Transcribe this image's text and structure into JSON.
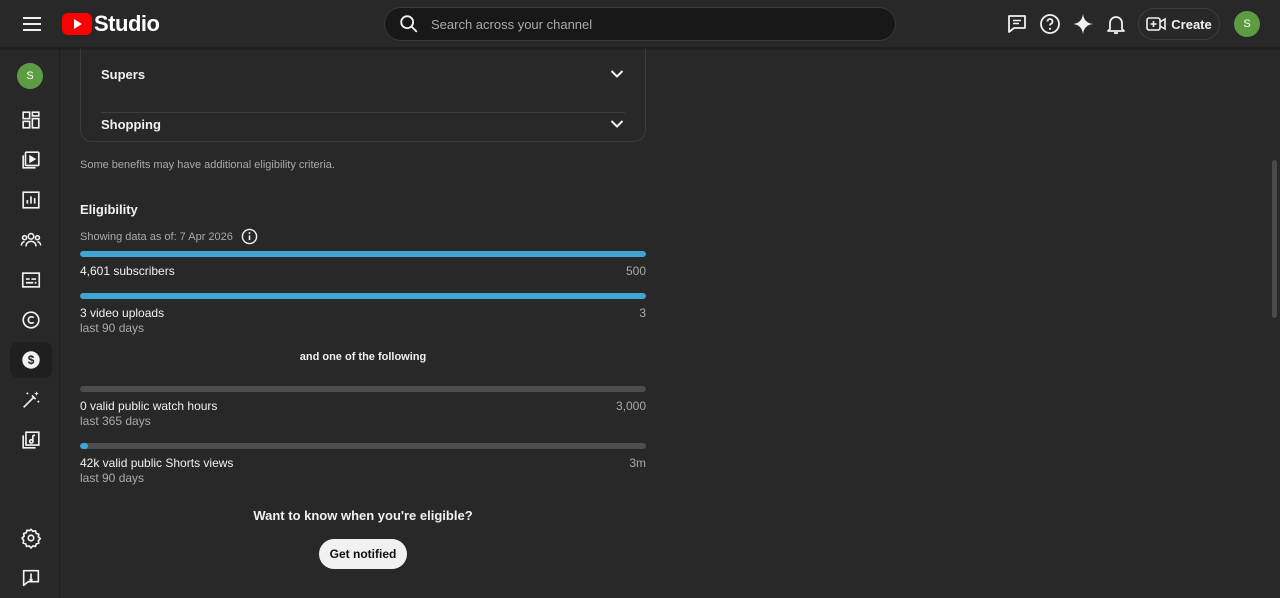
{
  "header": {
    "logo_text": "Studio",
    "search_placeholder": "Search across your channel",
    "create_label": "Create",
    "avatar_initial": "S"
  },
  "sidebar": {
    "avatar_initial": "S",
    "items": [
      {
        "icon": "dashboard-icon"
      },
      {
        "icon": "content-icon"
      },
      {
        "icon": "analytics-icon"
      },
      {
        "icon": "community-icon"
      },
      {
        "icon": "subtitles-icon"
      },
      {
        "icon": "copyright-icon"
      },
      {
        "icon": "earn-icon",
        "active": true
      },
      {
        "icon": "customization-icon"
      },
      {
        "icon": "audio-library-icon"
      },
      {
        "icon": "settings-icon"
      },
      {
        "icon": "feedback-icon"
      }
    ]
  },
  "benefits": {
    "accordions": [
      {
        "label": "Supers"
      },
      {
        "label": "Shopping"
      }
    ],
    "note": "Some benefits may have additional eligibility criteria."
  },
  "eligibility": {
    "title": "Eligibility",
    "as_of": "Showing data as of: 7 Apr 2026",
    "requirements": [
      {
        "label": "4,601 subscribers",
        "sub": "",
        "target": "500",
        "progress": 1.0
      },
      {
        "label": "3 video uploads",
        "sub": "last 90 days",
        "target": "3",
        "progress": 1.0
      }
    ],
    "and_one": "and one of the following",
    "options": [
      {
        "label": "0 valid public watch hours",
        "sub": "last 365 days",
        "target": "3,000",
        "progress": 0.0
      },
      {
        "label": "42k valid public Shorts views",
        "sub": "last 90 days",
        "target": "3m",
        "progress": 0.014
      }
    ],
    "notify_question": "Want to know when you're eligible?",
    "notify_button": "Get notified"
  },
  "colors": {
    "accent": "#3ea6d3",
    "brand_red": "#ff0000",
    "avatar_green": "#5e9c43"
  }
}
